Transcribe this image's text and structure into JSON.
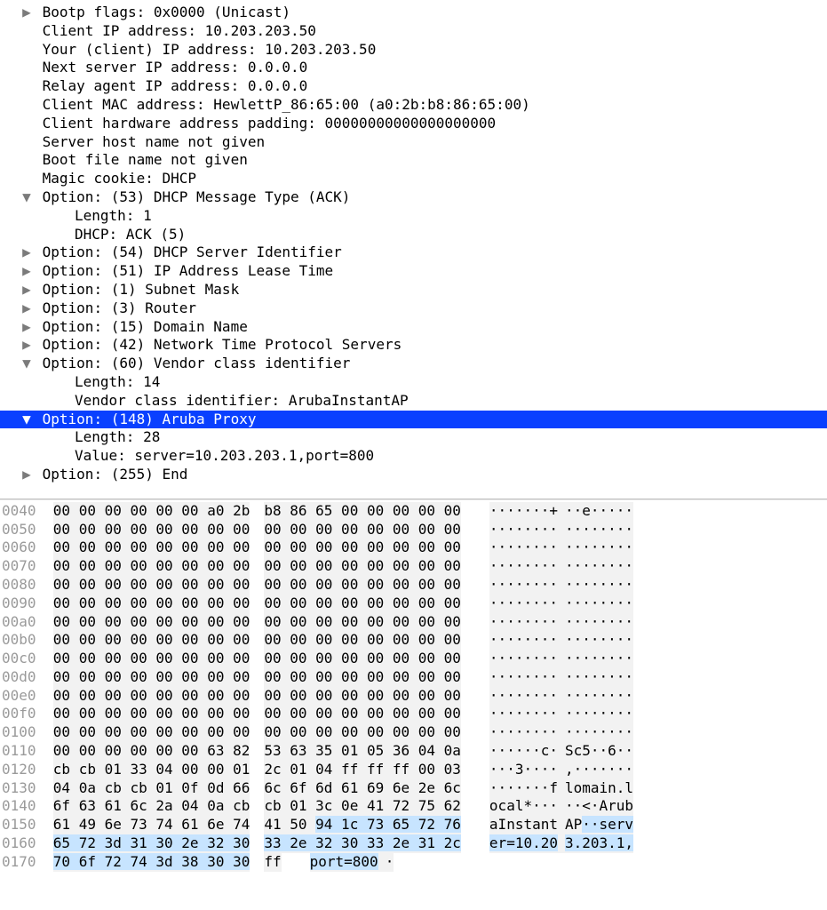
{
  "tree": {
    "bootp_flags": "Bootp flags: 0x0000 (Unicast)",
    "client_ip": "Client IP address: 10.203.203.50",
    "your_ip": "Your (client) IP address: 10.203.203.50",
    "next_server": "Next server IP address: 0.0.0.0",
    "relay_agent": "Relay agent IP address: 0.0.0.0",
    "client_mac": "Client MAC address: HewlettP_86:65:00 (a0:2b:b8:86:65:00)",
    "chaddr_pad": "Client hardware address padding: 00000000000000000000",
    "sname": "Server host name not given",
    "file": "Boot file name not given",
    "magic_cookie": "Magic cookie: DHCP",
    "opt53_hdr": "Option: (53) DHCP Message Type (ACK)",
    "opt53_len": "Length: 1",
    "opt53_val": "DHCP: ACK (5)",
    "opt54": "Option: (54) DHCP Server Identifier",
    "opt51": "Option: (51) IP Address Lease Time",
    "opt1": "Option: (1) Subnet Mask",
    "opt3": "Option: (3) Router",
    "opt15": "Option: (15) Domain Name",
    "opt42": "Option: (42) Network Time Protocol Servers",
    "opt60_hdr": "Option: (60) Vendor class identifier",
    "opt60_len": "Length: 14",
    "opt60_val": "Vendor class identifier: ArubaInstantAP",
    "opt148_hdr": "Option: (148) Aruba Proxy",
    "opt148_len": "Length: 28",
    "opt148_val": "Value: server=10.203.203.1,port=800",
    "opt255": "Option: (255) End"
  },
  "hexdump": [
    {
      "off": "0040",
      "l": "00 00 00 00 00 00 a0 2b",
      "r": "b8 86 65 00 00 00 00 00",
      "al": "·······+",
      "ar": "··e·····"
    },
    {
      "off": "0050",
      "l": "00 00 00 00 00 00 00 00",
      "r": "00 00 00 00 00 00 00 00",
      "al": "········",
      "ar": "········"
    },
    {
      "off": "0060",
      "l": "00 00 00 00 00 00 00 00",
      "r": "00 00 00 00 00 00 00 00",
      "al": "········",
      "ar": "········"
    },
    {
      "off": "0070",
      "l": "00 00 00 00 00 00 00 00",
      "r": "00 00 00 00 00 00 00 00",
      "al": "········",
      "ar": "········"
    },
    {
      "off": "0080",
      "l": "00 00 00 00 00 00 00 00",
      "r": "00 00 00 00 00 00 00 00",
      "al": "········",
      "ar": "········"
    },
    {
      "off": "0090",
      "l": "00 00 00 00 00 00 00 00",
      "r": "00 00 00 00 00 00 00 00",
      "al": "········",
      "ar": "········"
    },
    {
      "off": "00a0",
      "l": "00 00 00 00 00 00 00 00",
      "r": "00 00 00 00 00 00 00 00",
      "al": "········",
      "ar": "········"
    },
    {
      "off": "00b0",
      "l": "00 00 00 00 00 00 00 00",
      "r": "00 00 00 00 00 00 00 00",
      "al": "········",
      "ar": "········"
    },
    {
      "off": "00c0",
      "l": "00 00 00 00 00 00 00 00",
      "r": "00 00 00 00 00 00 00 00",
      "al": "········",
      "ar": "········"
    },
    {
      "off": "00d0",
      "l": "00 00 00 00 00 00 00 00",
      "r": "00 00 00 00 00 00 00 00",
      "al": "········",
      "ar": "········"
    },
    {
      "off": "00e0",
      "l": "00 00 00 00 00 00 00 00",
      "r": "00 00 00 00 00 00 00 00",
      "al": "········",
      "ar": "········"
    },
    {
      "off": "00f0",
      "l": "00 00 00 00 00 00 00 00",
      "r": "00 00 00 00 00 00 00 00",
      "al": "········",
      "ar": "········"
    },
    {
      "off": "0100",
      "l": "00 00 00 00 00 00 00 00",
      "r": "00 00 00 00 00 00 00 00",
      "al": "········",
      "ar": "········"
    },
    {
      "off": "0110",
      "l": "00 00 00 00 00 00 63 82",
      "r": "53 63 35 01 05 36 04 0a",
      "al": "······c·",
      "ar": "Sc5··6··"
    },
    {
      "off": "0120",
      "l": "cb cb 01 33 04 00 00 01",
      "r": "2c 01 04 ff ff ff 00 03",
      "al": "···3····",
      "ar": ",·······"
    },
    {
      "off": "0130",
      "l": "04 0a cb cb 01 0f 0d 66",
      "r": "6c 6f 6d 61 69 6e 2e 6c",
      "al": "·······f",
      "ar": "lomain.l"
    },
    {
      "off": "0140",
      "l": "6f 63 61 6c 2a 04 0a cb",
      "r": "cb 01 3c 0e 41 72 75 62",
      "al": "ocal*···",
      "ar": "··<·Arub"
    },
    {
      "off": "0150",
      "l": "61 49 6e 73 74 61 6e 74",
      "r_plain": "41 50 ",
      "r_hl": "94 1c 73 65 72 76",
      "al": "aInstant",
      "ar_plain": "AP",
      "ar_hl": "··serv"
    },
    {
      "off": "0160",
      "l_hl": "65 72 3d 31 30 2e 32 30",
      "r_hl": "33 2e 32 30 33 2e 31 2c",
      "al_hl": "er=10.20",
      "ar_hl": "3.203.1,"
    },
    {
      "off": "0170",
      "l_hl": "70 6f 72 74 3d 38 30 30",
      "r_plain": "ff",
      "al_hl": "port=800",
      "ar_plain": "·"
    }
  ]
}
